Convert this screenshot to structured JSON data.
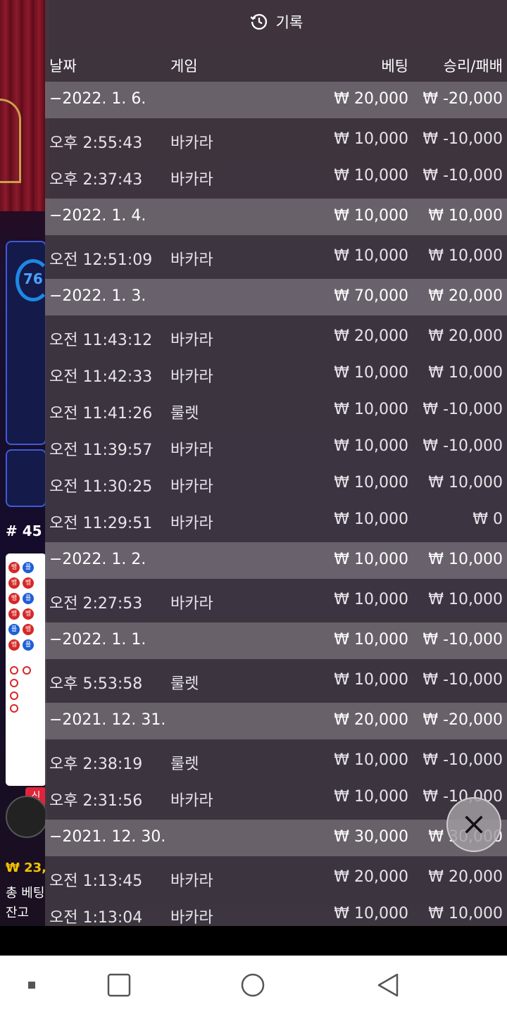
{
  "background": {
    "gauge_text": "76",
    "round_label": "# 45",
    "new_tag": "신",
    "balance": "₩ 23,",
    "total_bet": "총 베팅",
    "remain": "잔고"
  },
  "history": {
    "title": "기록",
    "columns": {
      "date": "날짜",
      "game": "게임",
      "bet": "베팅",
      "result": "승리/패배"
    },
    "rows": [
      {
        "type": "date",
        "date": "−2022. 1. 6.",
        "bet": "₩ 20,000",
        "result": "₩ -20,000"
      },
      {
        "type": "item",
        "time": "오후 2:55:43",
        "game": "바카라",
        "bet": "₩ 10,000",
        "result": "₩ -10,000"
      },
      {
        "type": "item",
        "time": "오후 2:37:43",
        "game": "바카라",
        "bet": "₩ 10,000",
        "result": "₩ -10,000"
      },
      {
        "type": "date",
        "date": "−2022. 1. 4.",
        "bet": "₩ 10,000",
        "result": "₩ 10,000"
      },
      {
        "type": "item",
        "time": "오전 12:51:09",
        "game": "바카라",
        "bet": "₩ 10,000",
        "result": "₩ 10,000"
      },
      {
        "type": "date",
        "date": "−2022. 1. 3.",
        "bet": "₩ 70,000",
        "result": "₩ 20,000"
      },
      {
        "type": "item",
        "time": "오전 11:43:12",
        "game": "바카라",
        "bet": "₩ 20,000",
        "result": "₩ 20,000"
      },
      {
        "type": "item",
        "time": "오전 11:42:33",
        "game": "바카라",
        "bet": "₩ 10,000",
        "result": "₩ 10,000"
      },
      {
        "type": "item",
        "time": "오전 11:41:26",
        "game": "룰렛",
        "bet": "₩ 10,000",
        "result": "₩ -10,000"
      },
      {
        "type": "item",
        "time": "오전 11:39:57",
        "game": "바카라",
        "bet": "₩ 10,000",
        "result": "₩ -10,000"
      },
      {
        "type": "item",
        "time": "오전 11:30:25",
        "game": "바카라",
        "bet": "₩ 10,000",
        "result": "₩ 10,000"
      },
      {
        "type": "item",
        "time": "오전 11:29:51",
        "game": "바카라",
        "bet": "₩ 10,000",
        "result": "₩ 0"
      },
      {
        "type": "date",
        "date": "−2022. 1. 2.",
        "bet": "₩ 10,000",
        "result": "₩ 10,000"
      },
      {
        "type": "item",
        "time": "오전 2:27:53",
        "game": "바카라",
        "bet": "₩ 10,000",
        "result": "₩ 10,000"
      },
      {
        "type": "date",
        "date": "−2022. 1. 1.",
        "bet": "₩ 10,000",
        "result": "₩ -10,000"
      },
      {
        "type": "item",
        "time": "오후 5:53:58",
        "game": "룰렛",
        "bet": "₩ 10,000",
        "result": "₩ -10,000"
      },
      {
        "type": "date",
        "date": "−2021. 12. 31.",
        "bet": "₩ 20,000",
        "result": "₩ -20,000"
      },
      {
        "type": "item",
        "time": "오후 2:38:19",
        "game": "룰렛",
        "bet": "₩ 10,000",
        "result": "₩ -10,000"
      },
      {
        "type": "item",
        "time": "오후 2:31:56",
        "game": "바카라",
        "bet": "₩ 10,000",
        "result": "₩ -10,000"
      },
      {
        "type": "date",
        "date": "−2021. 12. 30.",
        "bet": "₩ 30,000",
        "result": "₩ 30,000"
      },
      {
        "type": "item",
        "time": "오전 1:13:45",
        "game": "바카라",
        "bet": "₩ 20,000",
        "result": "₩ 20,000"
      },
      {
        "type": "item",
        "time": "오전 1:13:04",
        "game": "바카라",
        "bet": "₩ 10,000",
        "result": "₩ 10,000"
      }
    ]
  },
  "icons": {
    "history": "history-clock-icon",
    "close": "close-icon",
    "nav_recents": "square-dot-icon",
    "nav_overview": "square-icon",
    "nav_home": "circle-icon",
    "nav_back": "triangle-back-icon"
  }
}
